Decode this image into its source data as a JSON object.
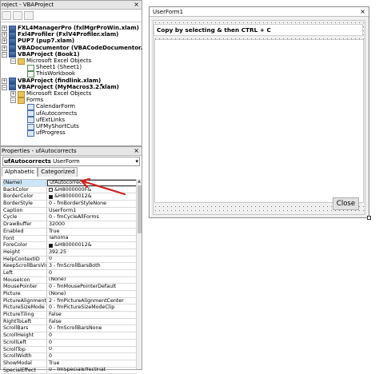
{
  "project": {
    "title": "roject - VBAProject",
    "close": "×",
    "nodes": [
      {
        "label": "FXL4ManagerPro (fxlMgrProWin.xlam)",
        "bold": true,
        "exp": "+",
        "icon": "proj"
      },
      {
        "label": "Fxl4Profiler (FxlV4Profiler.xlam)",
        "bold": true,
        "exp": "+",
        "icon": "proj"
      },
      {
        "label": "PUP7 (pup7.xlam)",
        "bold": true,
        "exp": "+",
        "icon": "proj"
      },
      {
        "label": "VBADocumentor (VBACodeDocumentor.xlam)",
        "bold": true,
        "exp": "+",
        "icon": "proj"
      },
      {
        "label": "VBAProject (Book1)",
        "bold": true,
        "exp": "−",
        "icon": "proj"
      },
      {
        "label": "Microsoft Excel Objects",
        "bold": false,
        "exp": "−",
        "icon": "folder"
      },
      {
        "label": "Sheet1 (Sheet1)",
        "bold": false,
        "exp": "",
        "icon": "sheet"
      },
      {
        "label": "ThisWorkbook",
        "bold": false,
        "exp": "",
        "icon": "sheet"
      },
      {
        "label": "VBAProject (findlink.xlam)",
        "bold": true,
        "exp": "+",
        "icon": "proj"
      },
      {
        "label": "VBAProject (MyMacros3.2.xlam)",
        "bold": true,
        "exp": "−",
        "icon": "proj"
      },
      {
        "label": "Microsoft Excel Objects",
        "bold": false,
        "exp": "+",
        "icon": "folder"
      },
      {
        "label": "Forms",
        "bold": false,
        "exp": "−",
        "icon": "folder"
      },
      {
        "label": "CalendarForm",
        "bold": false,
        "exp": "",
        "icon": "form"
      },
      {
        "label": "ufAutocorrects",
        "bold": false,
        "exp": "",
        "icon": "form"
      },
      {
        "label": "ufExtLinks",
        "bold": false,
        "exp": "",
        "icon": "form"
      },
      {
        "label": "UFMyShortCuts",
        "bold": false,
        "exp": "",
        "icon": "form"
      },
      {
        "label": "ufProgress",
        "bold": false,
        "exp": "",
        "icon": "form"
      }
    ]
  },
  "properties": {
    "title": "Properties - ufAutocorrects",
    "close": "×",
    "object_name": "ufAutocorrects",
    "object_type": "UserForm",
    "tabs": [
      "Alphabetic",
      "Categorized"
    ],
    "rows": [
      {
        "name": "(Name)",
        "value": "ufAutocorrects",
        "selected": true
      },
      {
        "name": "BackColor",
        "value": "&H8000000F&",
        "swatch": "#f0f0f0"
      },
      {
        "name": "BorderColor",
        "value": "&H80000012&",
        "swatch": "#000000"
      },
      {
        "name": "BorderStyle",
        "value": "0 - fmBorderStyleNone"
      },
      {
        "name": "Caption",
        "value": "UserForm1"
      },
      {
        "name": "Cycle",
        "value": "0 - fmCycleAllForms"
      },
      {
        "name": "DrawBuffer",
        "value": "32000"
      },
      {
        "name": "Enabled",
        "value": "True"
      },
      {
        "name": "Font",
        "value": "Tahoma"
      },
      {
        "name": "ForeColor",
        "value": "&H80000012&",
        "swatch": "#000000"
      },
      {
        "name": "Height",
        "value": "392.25"
      },
      {
        "name": "HelpContextID",
        "value": "0"
      },
      {
        "name": "KeepScrollBarsVisible",
        "value": "3 - fmScrollBarsBoth"
      },
      {
        "name": "Left",
        "value": "0"
      },
      {
        "name": "MouseIcon",
        "value": "(None)"
      },
      {
        "name": "MousePointer",
        "value": "0 - fmMousePointerDefault"
      },
      {
        "name": "Picture",
        "value": "(None)"
      },
      {
        "name": "PictureAlignment",
        "value": "2 - fmPictureAlignmentCenter"
      },
      {
        "name": "PictureSizeMode",
        "value": "0 - fmPictureSizeModeClip"
      },
      {
        "name": "PictureTiling",
        "value": "False"
      },
      {
        "name": "RightToLeft",
        "value": "False"
      },
      {
        "name": "ScrollBars",
        "value": "0 - fmScrollBarsNone"
      },
      {
        "name": "ScrollHeight",
        "value": "0"
      },
      {
        "name": "ScrollLeft",
        "value": "0"
      },
      {
        "name": "ScrollTop",
        "value": "0"
      },
      {
        "name": "ScrollWidth",
        "value": "0"
      },
      {
        "name": "ShowModal",
        "value": "True"
      },
      {
        "name": "SpecialEffect",
        "value": "0 - fmSpecialEffectFlat"
      }
    ]
  },
  "userform": {
    "title": "UserForm1",
    "close": "×",
    "label_text": "Copy by selecting & then CTRL + C",
    "close_button": "Close"
  },
  "colors": {
    "arrow": "#d42020",
    "selected_name_bg": "#cce4f7"
  },
  "icons": {
    "pointer": "↖"
  }
}
